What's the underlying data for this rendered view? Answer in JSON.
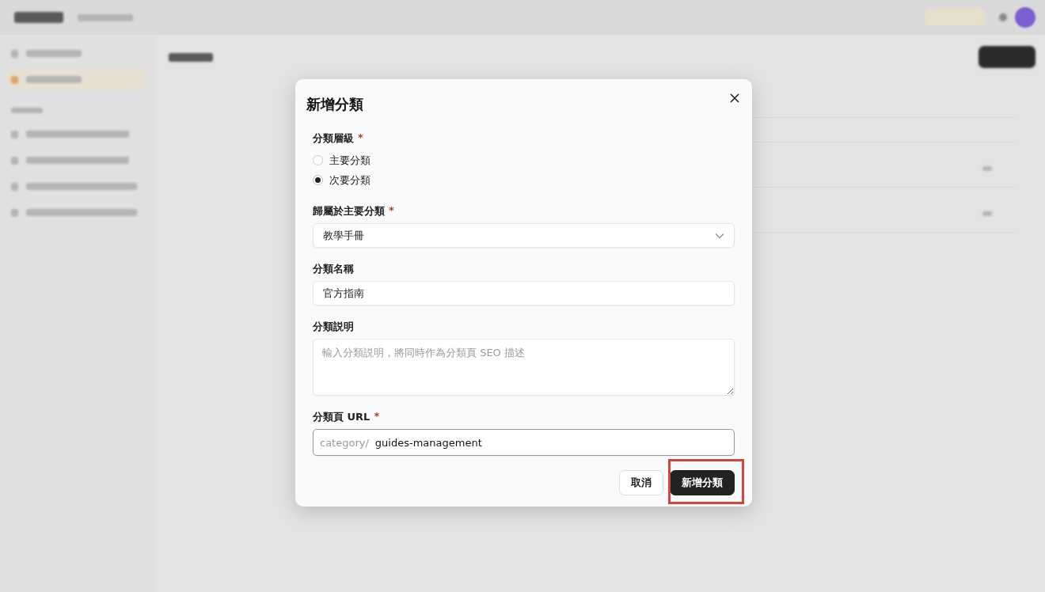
{
  "dialog": {
    "title": "新增分類",
    "fields": [
      {
        "kind": "radio",
        "label": "分類層級",
        "marker": "*",
        "options": [
          {
            "label": "主要分類",
            "selected": false
          },
          {
            "label": "次要分類",
            "selected": true
          }
        ]
      },
      {
        "kind": "select",
        "label": "歸屬於主要分類",
        "marker": "*",
        "value": "教學手冊"
      },
      {
        "kind": "text",
        "label": "分類名稱",
        "value": "官方指南"
      },
      {
        "kind": "textarea",
        "label": "分類説明",
        "placeholder": "輸入分類説明，將同時作為分類頁 SEO 描述"
      },
      {
        "kind": "prefixed",
        "label": "分類頁 URL",
        "marker": "*",
        "prefix": "category/",
        "value": "guides-management"
      }
    ],
    "buttons": [
      {
        "label": "取消",
        "kind": "secondary",
        "highlighted": false
      },
      {
        "label": "新增分類",
        "kind": "primary",
        "highlighted": true
      }
    ]
  }
}
